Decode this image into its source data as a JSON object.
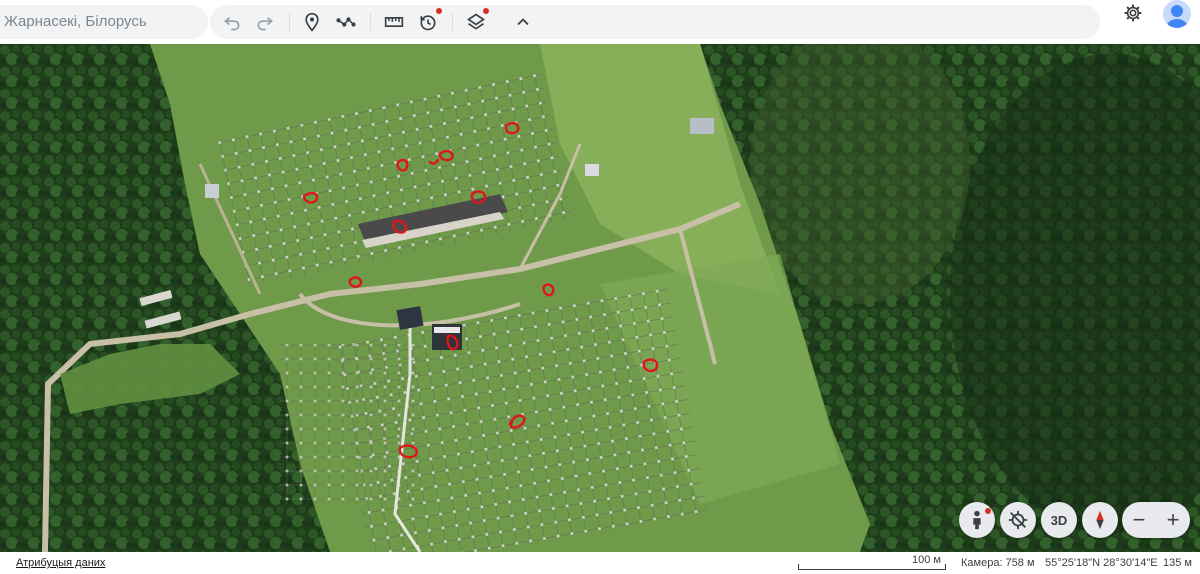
{
  "search": {
    "value": "Жарнасекі, Білорусь"
  },
  "toolbar": {
    "tools": [
      {
        "name": "undo-icon"
      },
      {
        "name": "redo-icon"
      },
      {
        "name": "placemark-icon"
      },
      {
        "name": "path-icon"
      },
      {
        "name": "measure-icon"
      },
      {
        "name": "historical-imagery-icon"
      },
      {
        "name": "layers-icon"
      },
      {
        "name": "collapse-icon"
      }
    ]
  },
  "header": {
    "settings_icon": "gear-icon",
    "avatar_icon": "account-icon"
  },
  "map": {
    "view": "satellite",
    "annotation_color": "#e0141b",
    "annotation_count": 13
  },
  "controls": {
    "pegman_icon": "pegman-icon",
    "recenter_icon": "location-off-icon",
    "view3d_label": "3D",
    "compass_icon": "compass-icon",
    "zoom_out_label": "−",
    "zoom_in_label": "+"
  },
  "status": {
    "attribution": "Атрибуцыя даних",
    "scale": "100 м",
    "camera": "Камера: 758 м",
    "coords": "55°25'18\"N 28°30'14\"E",
    "elevation": "135 м"
  }
}
